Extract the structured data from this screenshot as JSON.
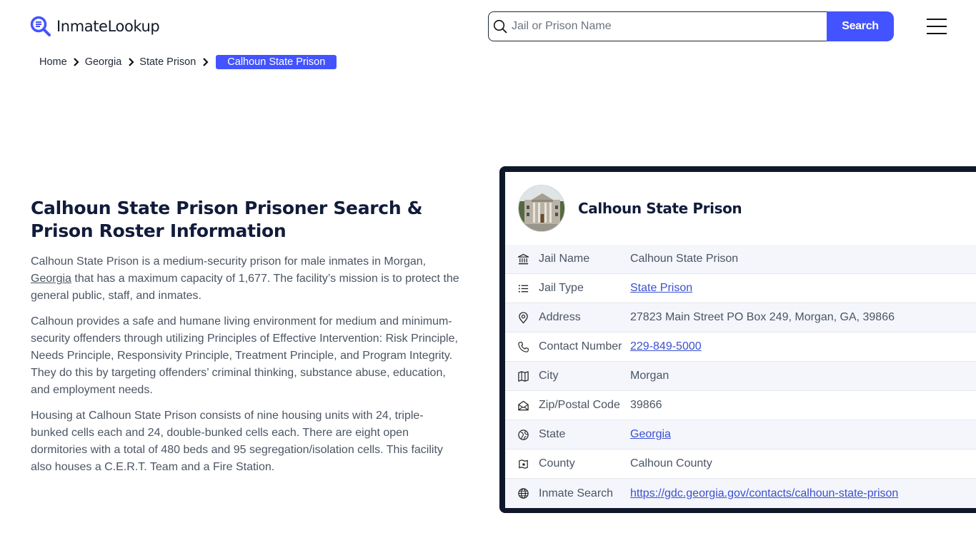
{
  "header": {
    "logo_text": "InmateLookup",
    "search_placeholder": "Jail or Prison Name",
    "search_value": "",
    "search_button_label": "Search",
    "brand_color": "#4353ff"
  },
  "breadcrumb": [
    {
      "label": "Home"
    },
    {
      "label": "Georgia"
    },
    {
      "label": "State Prison"
    },
    {
      "label": "Calhoun State Prison",
      "active": true
    }
  ],
  "article": {
    "title": "Calhoun State Prison Prisoner Search & Prison Roster Information",
    "p1_before": "Calhoun State Prison is a medium-security prison for male inmates in Morgan, ",
    "p1_link": "Georgia",
    "p1_after": " that has a maximum capacity of 1,677. The facility’s mission is to protect the general public, staff, and inmates.",
    "p2": "Calhoun provides a safe and humane living environment for medium and minimum-security offenders through utilizing Principles of Effective Intervention: Risk Principle, Needs Principle, Responsivity Principle, Treatment Principle, and Program Integrity. They do this by targeting offenders’ criminal thinking, substance abuse, education, and employment needs.",
    "p3": "Housing at Calhoun State Prison consists of nine housing units with 24, triple-bunked cells each and 24, double-bunked cells each. There are eight open dormitories with a total of 480 beds and 95 segregation/isolation cells. This facility also houses a C.E.R.T. Team and a Fire Station."
  },
  "card": {
    "title": "Calhoun State Prison",
    "image_alt": "Calhoun State Prison building",
    "rows": [
      {
        "icon": "bank-icon",
        "label": "Jail Name",
        "value": "Calhoun State Prison",
        "link": false
      },
      {
        "icon": "list-icon",
        "label": "Jail Type",
        "value": "State Prison",
        "link": true
      },
      {
        "icon": "map-pin-icon",
        "label": "Address",
        "value": "27823 Main Street PO Box 249, Morgan, GA, 39866",
        "link": false
      },
      {
        "icon": "phone-icon",
        "label": "Contact Number",
        "value": "229-849-5000",
        "link": true
      },
      {
        "icon": "map-icon",
        "label": "City",
        "value": "Morgan",
        "link": false
      },
      {
        "icon": "mail-open-icon",
        "label": "Zip/Postal Code",
        "value": "39866",
        "link": false
      },
      {
        "icon": "compass-globe-icon",
        "label": "State",
        "value": "Georgia",
        "link": true
      },
      {
        "icon": "county-map-icon",
        "label": "County",
        "value": "Calhoun County",
        "link": false
      },
      {
        "icon": "globe-icon",
        "label": "Inmate Search",
        "value": "https://gdc.georgia.gov/contacts/calhoun-state-prison",
        "link": true
      }
    ]
  }
}
